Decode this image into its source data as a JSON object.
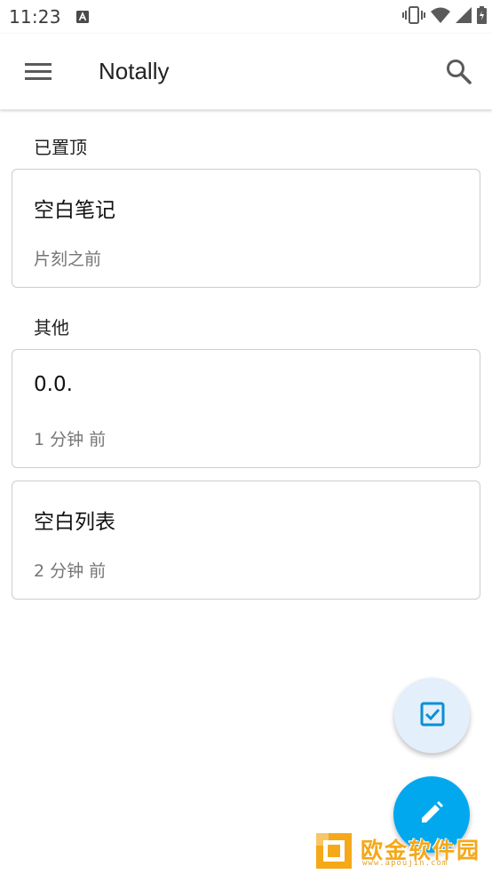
{
  "status_bar": {
    "time": "11:23",
    "icons": [
      "text-notification-icon",
      "vibrate-icon",
      "wifi-icon",
      "cell-signal-icon",
      "battery-charging-icon"
    ]
  },
  "app_bar": {
    "title": "Notally",
    "menu_icon": "hamburger-menu-icon",
    "search_icon": "search-icon"
  },
  "sections": {
    "pinned": {
      "label": "已置顶"
    },
    "others": {
      "label": "其他"
    }
  },
  "notes": [
    {
      "title": "空白笔记",
      "time": "片刻之前"
    },
    {
      "title": "0.0.",
      "time": "1 分钟 前"
    },
    {
      "title": "空白列表",
      "time": "2 分钟 前"
    }
  ],
  "fabs": {
    "new_list_icon": "checkbox-icon",
    "new_note_icon": "pencil-icon"
  },
  "colors": {
    "accent": "#02a8ee",
    "fab_secondary": "#e3effb",
    "card_border": "#cdcdcd",
    "secondary_text": "#757575"
  },
  "watermark": {
    "text": "欧金软件园",
    "url": "www.apoujin.com"
  }
}
